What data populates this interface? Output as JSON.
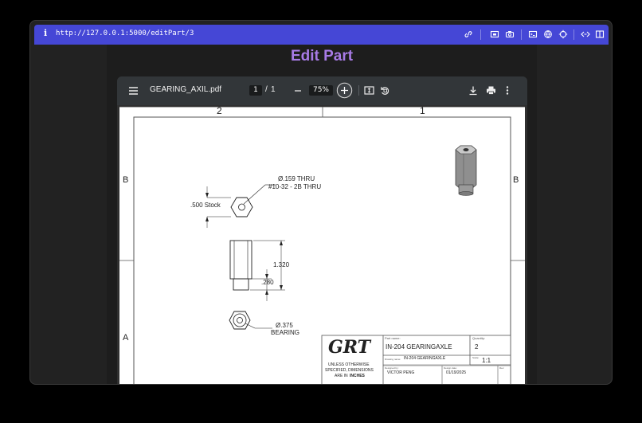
{
  "browser": {
    "info_icon": "info-icon",
    "url": "http://127.0.0.1:5000/editPart/3",
    "toolbar_icons": [
      "link-icon",
      "screenshot-icon",
      "camera-icon",
      "terminal-icon",
      "network-icon",
      "crosshair-icon",
      "code-icon",
      "sidebar-icon"
    ],
    "accent": "#4547d6"
  },
  "page": {
    "title": "Edit Part",
    "title_color": "#a87be6"
  },
  "pdf_viewer": {
    "file_name": "GEARING_AXIL.pdf",
    "current_page": "1",
    "page_sep": "/",
    "total_pages": "1",
    "zoom": "75%"
  },
  "drawing": {
    "zone_top_left": "2",
    "zone_top_right": "1",
    "zone_left_b": "B",
    "zone_right_b": "B",
    "zone_left_a": "A",
    "callout_thru": "Ø.159 THRU",
    "callout_thread": "#10-32 - 2B THRU",
    "stock": ".500 Stock",
    "dim_length": "1.320",
    "dim_small": ".280",
    "callout_bearing_dia": "Ø.375",
    "callout_bearing": "BEARING",
    "title_block": {
      "logo": "GRT",
      "part_name_label": "Part name:",
      "part_name": "IN-204 GEARINGAXLE",
      "quantity_label": "Quantity:",
      "quantity": "2",
      "drawing_name_label": "Drawing name:",
      "drawing_name": "IN-204 GEARINGAXLE",
      "scale_label": "Scale:",
      "scale": "1:1",
      "note_1": "UNLESS OTHERWISE",
      "note_2": "SPECIFIED, DIMENSIONS",
      "note_3": "ARE IN",
      "note_units": "INCHES",
      "designed_by_label": "Designed by:",
      "designed_by": "VICTOR PENG",
      "design_date_label": "Design date:",
      "design_date": "01/19/2025",
      "rev_label": "Rev:"
    }
  }
}
